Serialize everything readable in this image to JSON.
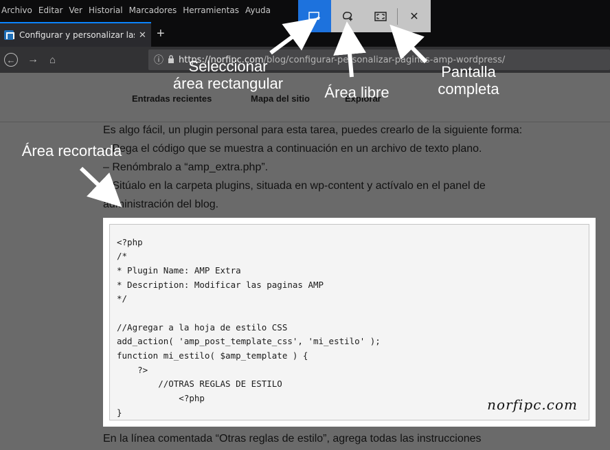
{
  "menu": [
    "Archivo",
    "Editar",
    "Ver",
    "Historial",
    "Marcadores",
    "Herramientas",
    "Ayuda"
  ],
  "tab": {
    "title": "Configurar y personalizar las pa",
    "close": "✕"
  },
  "newtab": "+",
  "nav": {
    "back": "←",
    "forward": "→",
    "home": "⌂"
  },
  "url": {
    "info": "ⓘ",
    "lock": "🔒",
    "host": "https://norfipc.com",
    "path": "/blog/configurar-personalizar-paginas-amp-wordpress/"
  },
  "screenshot_toolbar": {
    "buttons": [
      {
        "icon": "select-region-icon",
        "active": true
      },
      {
        "icon": "freeform-region-icon",
        "active": false
      },
      {
        "icon": "fullscreen-icon",
        "active": false
      },
      {
        "icon": "close-icon",
        "active": false
      }
    ],
    "close_glyph": "✕"
  },
  "site_nav": [
    "Entradas recientes",
    "Mapa del sitio",
    "Explorar"
  ],
  "paragraphs": [
    "Es algo fácil, un plugin personal para esta tarea, puedes crearlo de la siguiente forma:",
    "– Pega el código que se muestra a continuación en un archivo de texto plano.",
    "– Renómbralo a “amp_extra.php”.",
    "– Sitúalo en la carpeta plugins, situada en wp-content y actívalo en el panel de",
    "administración del blog."
  ],
  "code_lines": [
    "<?php",
    "/*",
    "* Plugin Name: AMP Extra",
    "* Description: Modificar las paginas AMP",
    "*/",
    "",
    "//Agregar a la hoja de estilo CSS",
    "add_action( 'amp_post_template_css', 'mi_estilo' );",
    "function mi_estilo( $amp_template ) {",
    "    ?>",
    "        //OTRAS REGLAS DE ESTILO",
    "            <?php",
    "}"
  ],
  "watermark": "norfipc.com",
  "footer_paragraph": "En la línea comentada “Otras reglas de estilo”, agrega todas las instrucciones",
  "annotations": {
    "select": [
      "Seleccionar",
      "área rectangular"
    ],
    "free": "Área libre",
    "full": [
      "Pantalla",
      "completa"
    ],
    "cropped": "Área recortada"
  },
  "colors": {
    "accent": "#1d72dd",
    "dim_overlay": "#6a6a6a",
    "annotation_text": "#ffffff"
  }
}
